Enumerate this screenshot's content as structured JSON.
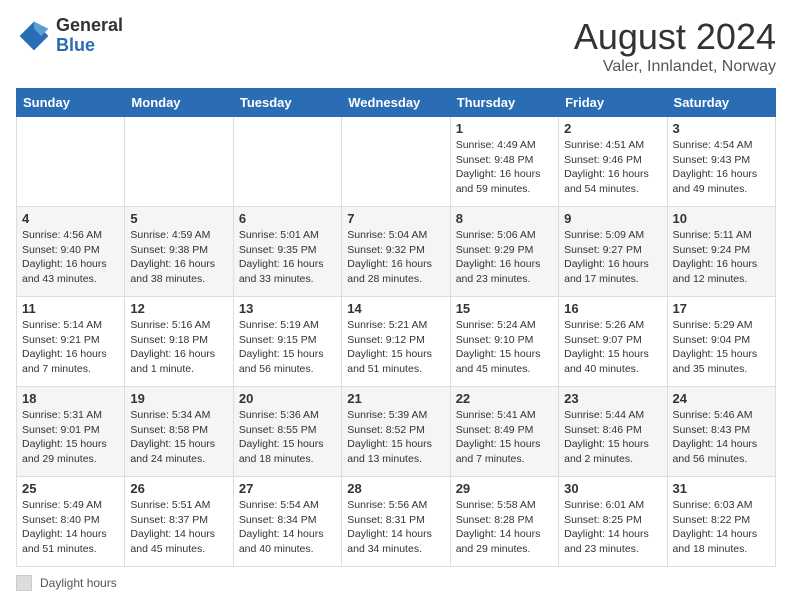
{
  "header": {
    "logo_general": "General",
    "logo_blue": "Blue",
    "month_year": "August 2024",
    "location": "Valer, Innlandet, Norway"
  },
  "days_of_week": [
    "Sunday",
    "Monday",
    "Tuesday",
    "Wednesday",
    "Thursday",
    "Friday",
    "Saturday"
  ],
  "weeks": [
    [
      {
        "day": "",
        "info": ""
      },
      {
        "day": "",
        "info": ""
      },
      {
        "day": "",
        "info": ""
      },
      {
        "day": "",
        "info": ""
      },
      {
        "day": "1",
        "info": "Sunrise: 4:49 AM\nSunset: 9:48 PM\nDaylight: 16 hours\nand 59 minutes."
      },
      {
        "day": "2",
        "info": "Sunrise: 4:51 AM\nSunset: 9:46 PM\nDaylight: 16 hours\nand 54 minutes."
      },
      {
        "day": "3",
        "info": "Sunrise: 4:54 AM\nSunset: 9:43 PM\nDaylight: 16 hours\nand 49 minutes."
      }
    ],
    [
      {
        "day": "4",
        "info": "Sunrise: 4:56 AM\nSunset: 9:40 PM\nDaylight: 16 hours\nand 43 minutes."
      },
      {
        "day": "5",
        "info": "Sunrise: 4:59 AM\nSunset: 9:38 PM\nDaylight: 16 hours\nand 38 minutes."
      },
      {
        "day": "6",
        "info": "Sunrise: 5:01 AM\nSunset: 9:35 PM\nDaylight: 16 hours\nand 33 minutes."
      },
      {
        "day": "7",
        "info": "Sunrise: 5:04 AM\nSunset: 9:32 PM\nDaylight: 16 hours\nand 28 minutes."
      },
      {
        "day": "8",
        "info": "Sunrise: 5:06 AM\nSunset: 9:29 PM\nDaylight: 16 hours\nand 23 minutes."
      },
      {
        "day": "9",
        "info": "Sunrise: 5:09 AM\nSunset: 9:27 PM\nDaylight: 16 hours\nand 17 minutes."
      },
      {
        "day": "10",
        "info": "Sunrise: 5:11 AM\nSunset: 9:24 PM\nDaylight: 16 hours\nand 12 minutes."
      }
    ],
    [
      {
        "day": "11",
        "info": "Sunrise: 5:14 AM\nSunset: 9:21 PM\nDaylight: 16 hours\nand 7 minutes."
      },
      {
        "day": "12",
        "info": "Sunrise: 5:16 AM\nSunset: 9:18 PM\nDaylight: 16 hours\nand 1 minute."
      },
      {
        "day": "13",
        "info": "Sunrise: 5:19 AM\nSunset: 9:15 PM\nDaylight: 15 hours\nand 56 minutes."
      },
      {
        "day": "14",
        "info": "Sunrise: 5:21 AM\nSunset: 9:12 PM\nDaylight: 15 hours\nand 51 minutes."
      },
      {
        "day": "15",
        "info": "Sunrise: 5:24 AM\nSunset: 9:10 PM\nDaylight: 15 hours\nand 45 minutes."
      },
      {
        "day": "16",
        "info": "Sunrise: 5:26 AM\nSunset: 9:07 PM\nDaylight: 15 hours\nand 40 minutes."
      },
      {
        "day": "17",
        "info": "Sunrise: 5:29 AM\nSunset: 9:04 PM\nDaylight: 15 hours\nand 35 minutes."
      }
    ],
    [
      {
        "day": "18",
        "info": "Sunrise: 5:31 AM\nSunset: 9:01 PM\nDaylight: 15 hours\nand 29 minutes."
      },
      {
        "day": "19",
        "info": "Sunrise: 5:34 AM\nSunset: 8:58 PM\nDaylight: 15 hours\nand 24 minutes."
      },
      {
        "day": "20",
        "info": "Sunrise: 5:36 AM\nSunset: 8:55 PM\nDaylight: 15 hours\nand 18 minutes."
      },
      {
        "day": "21",
        "info": "Sunrise: 5:39 AM\nSunset: 8:52 PM\nDaylight: 15 hours\nand 13 minutes."
      },
      {
        "day": "22",
        "info": "Sunrise: 5:41 AM\nSunset: 8:49 PM\nDaylight: 15 hours\nand 7 minutes."
      },
      {
        "day": "23",
        "info": "Sunrise: 5:44 AM\nSunset: 8:46 PM\nDaylight: 15 hours\nand 2 minutes."
      },
      {
        "day": "24",
        "info": "Sunrise: 5:46 AM\nSunset: 8:43 PM\nDaylight: 14 hours\nand 56 minutes."
      }
    ],
    [
      {
        "day": "25",
        "info": "Sunrise: 5:49 AM\nSunset: 8:40 PM\nDaylight: 14 hours\nand 51 minutes."
      },
      {
        "day": "26",
        "info": "Sunrise: 5:51 AM\nSunset: 8:37 PM\nDaylight: 14 hours\nand 45 minutes."
      },
      {
        "day": "27",
        "info": "Sunrise: 5:54 AM\nSunset: 8:34 PM\nDaylight: 14 hours\nand 40 minutes."
      },
      {
        "day": "28",
        "info": "Sunrise: 5:56 AM\nSunset: 8:31 PM\nDaylight: 14 hours\nand 34 minutes."
      },
      {
        "day": "29",
        "info": "Sunrise: 5:58 AM\nSunset: 8:28 PM\nDaylight: 14 hours\nand 29 minutes."
      },
      {
        "day": "30",
        "info": "Sunrise: 6:01 AM\nSunset: 8:25 PM\nDaylight: 14 hours\nand 23 minutes."
      },
      {
        "day": "31",
        "info": "Sunrise: 6:03 AM\nSunset: 8:22 PM\nDaylight: 14 hours\nand 18 minutes."
      }
    ]
  ],
  "footer": {
    "label": "Daylight hours"
  }
}
